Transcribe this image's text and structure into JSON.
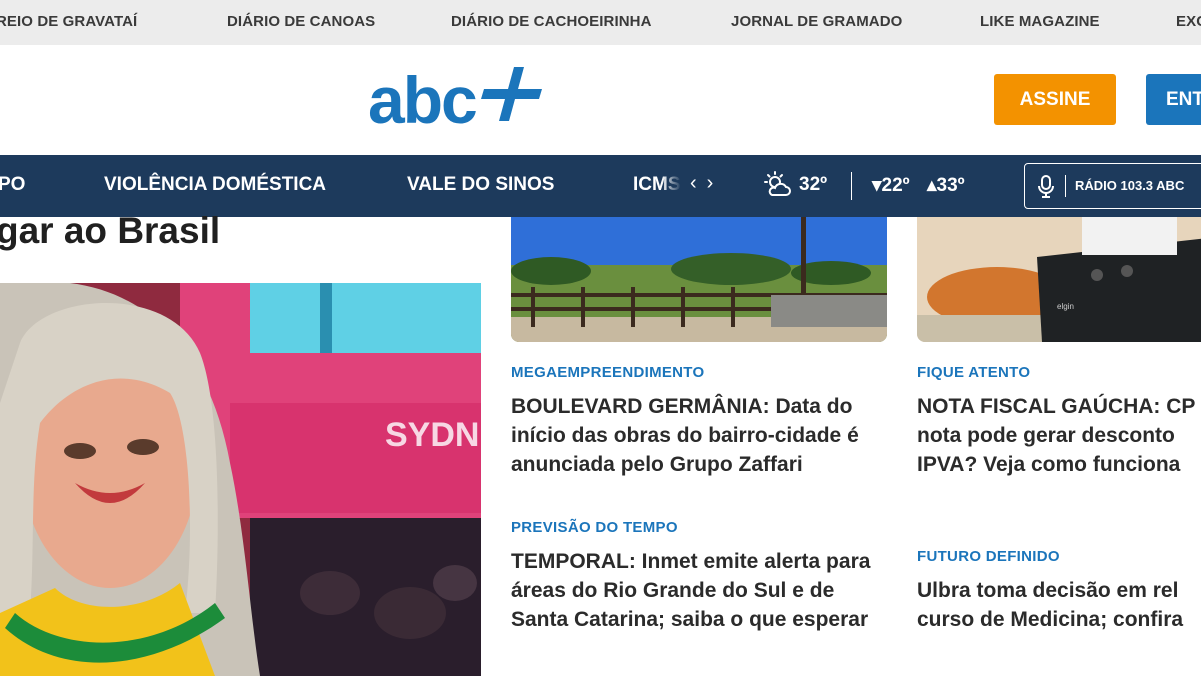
{
  "partners": [
    "REIO DE GRAVATAÍ",
    "DIÁRIO DE CANOAS",
    "DIÁRIO DE CACHOEIRINHA",
    "JORNAL DE GRAMADO",
    "LIKE MAGAZINE",
    "EXC"
  ],
  "header": {
    "logo_text": "abc",
    "subscribe_label": "ASSINE",
    "login_label": "ENT"
  },
  "nav": {
    "items": [
      "PO",
      "VIOLÊNCIA DOMÉSTICA",
      "VALE DO SINOS",
      "ICMS"
    ],
    "prev_arrow": "‹",
    "next_arrow": "›",
    "weather_icon": "partly-cloudy-sun-icon",
    "temp_now": "32º",
    "temp_min": "▾22º",
    "temp_max": "▴33º",
    "radio_label": "RÁDIO 103.3 ABC"
  },
  "lead": {
    "headline": "gar ao Brasil",
    "photo_text": "SYDN"
  },
  "articles": [
    {
      "kicker": "MEGAEMPREENDIMENTO",
      "headline": "BOULEVARD GERMÂNIA: Data do início das obras do bairro-cidade é anunciada pelo Grupo Zaffari"
    },
    {
      "kicker": "FIQUE ATENTO",
      "headline": "NOTA FISCAL GAÚCHA: CP nota pode gerar desconto IPVA? Veja como funciona"
    },
    {
      "kicker": "PREVISÃO DO TEMPO",
      "headline": "TEMPORAL: Inmet emite alerta para áreas do Rio Grande do Sul e de Santa Catarina; saiba o que esperar"
    },
    {
      "kicker": "FUTURO DEFINIDO",
      "headline": "Ulbra toma decisão em rel curso de Medicina; confira"
    }
  ],
  "colors": {
    "accent_blue": "#1b75bb",
    "nav_bg": "#1d3a5c",
    "subscribe_orange": "#f39200"
  }
}
